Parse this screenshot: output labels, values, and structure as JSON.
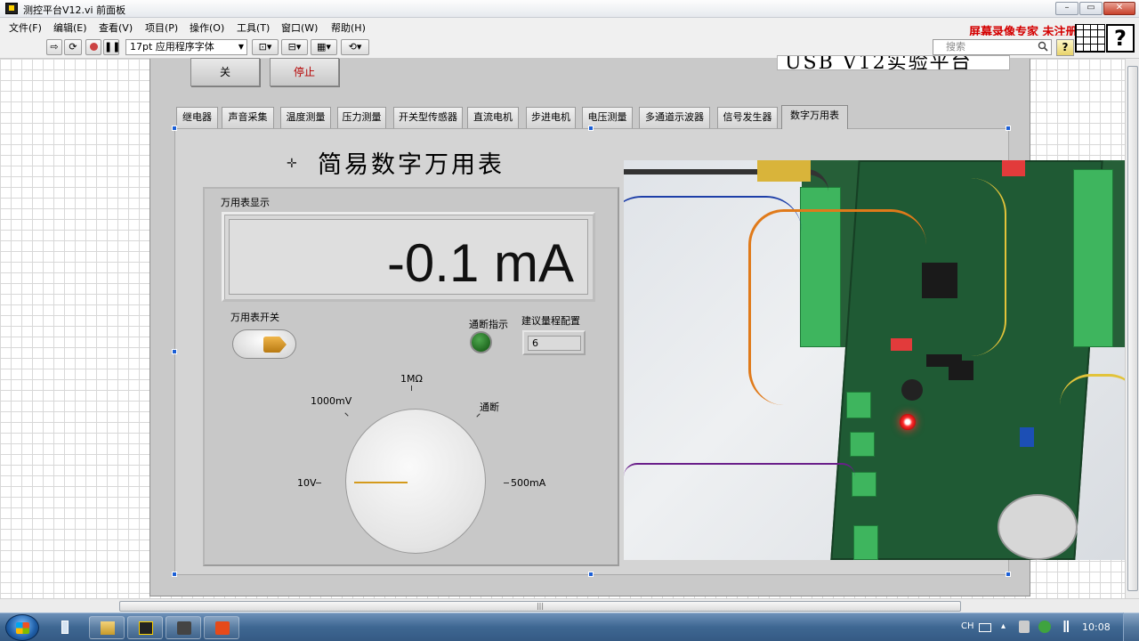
{
  "window": {
    "title": "测控平台V12.vi 前面板",
    "min_label": "–",
    "max_label": "▭",
    "close_label": "✕"
  },
  "menu": [
    "文件(F)",
    "编辑(E)",
    "查看(V)",
    "项目(P)",
    "操作(O)",
    "工具(T)",
    "窗口(W)",
    "帮助(H)"
  ],
  "recorder_watermark": "屏幕录像专家 未注册",
  "toolbar": {
    "font_select": "17pt 应用程序字体",
    "search_placeholder": "搜索",
    "help_label": "?",
    "context_help": "?"
  },
  "panel": {
    "close_button": "关",
    "stop_button": "停止",
    "banner_text": "USB V12实验平台",
    "tabs": [
      "继电器",
      "声音采集",
      "温度测量",
      "压力测量",
      "开关型传感器",
      "直流电机",
      "步进电机",
      "电压测量",
      "多通道示波器",
      "信号发生器",
      "数字万用表"
    ],
    "active_tab": "数字万用表",
    "page_title": "简易数字万用表",
    "meter_display_label": "万用表显示",
    "meter_value": "-0.1 mA",
    "meter_switch_label": "万用表开关",
    "continuity_label": "通断指示",
    "range_label": "建议量程配置",
    "range_value": "6",
    "dial": {
      "label_1mohm": "1MΩ",
      "label_1000mv": "1000mV",
      "label_continuity": "通断",
      "label_10v": "10V",
      "label_500ma": "500mA"
    }
  },
  "taskbar": {
    "lang": "CH",
    "clock": "10:08"
  },
  "colors": {
    "led_on": "#2e8b2e",
    "pointer": "#d49a1c",
    "toggle_knob": "#d8921f",
    "stop_text": "#b50000",
    "recorder_text": "#d40000"
  }
}
